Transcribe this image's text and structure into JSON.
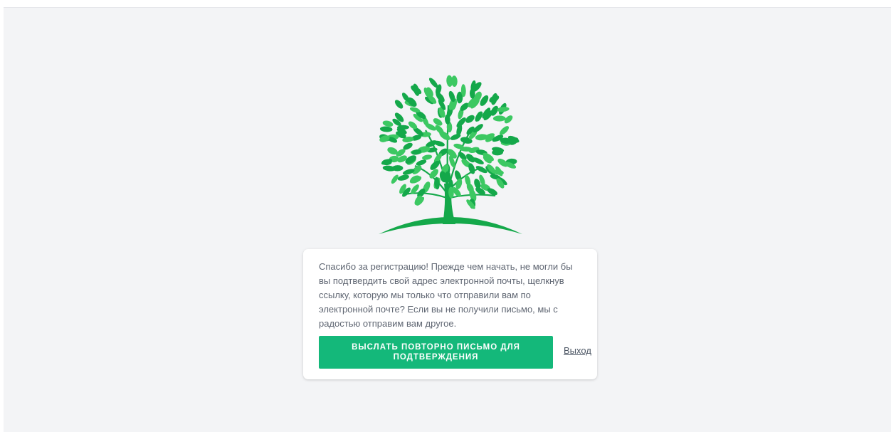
{
  "brand": {
    "logo_icon": "tree-logo-icon",
    "color": "#14a84a"
  },
  "verify": {
    "message": "Спасибо за регистрацию! Прежде чем начать, не могли бы вы подтвердить свой адрес электронной почты, щелкнув ссылку, которую мы только что отправили вам по электронной почте? Если вы не получили письмо, мы с радостью отправим вам другое.",
    "resend_label": "Выслать повторно письмо для подтверждения",
    "logout_label": "Выход",
    "accent": "#14b87a"
  }
}
